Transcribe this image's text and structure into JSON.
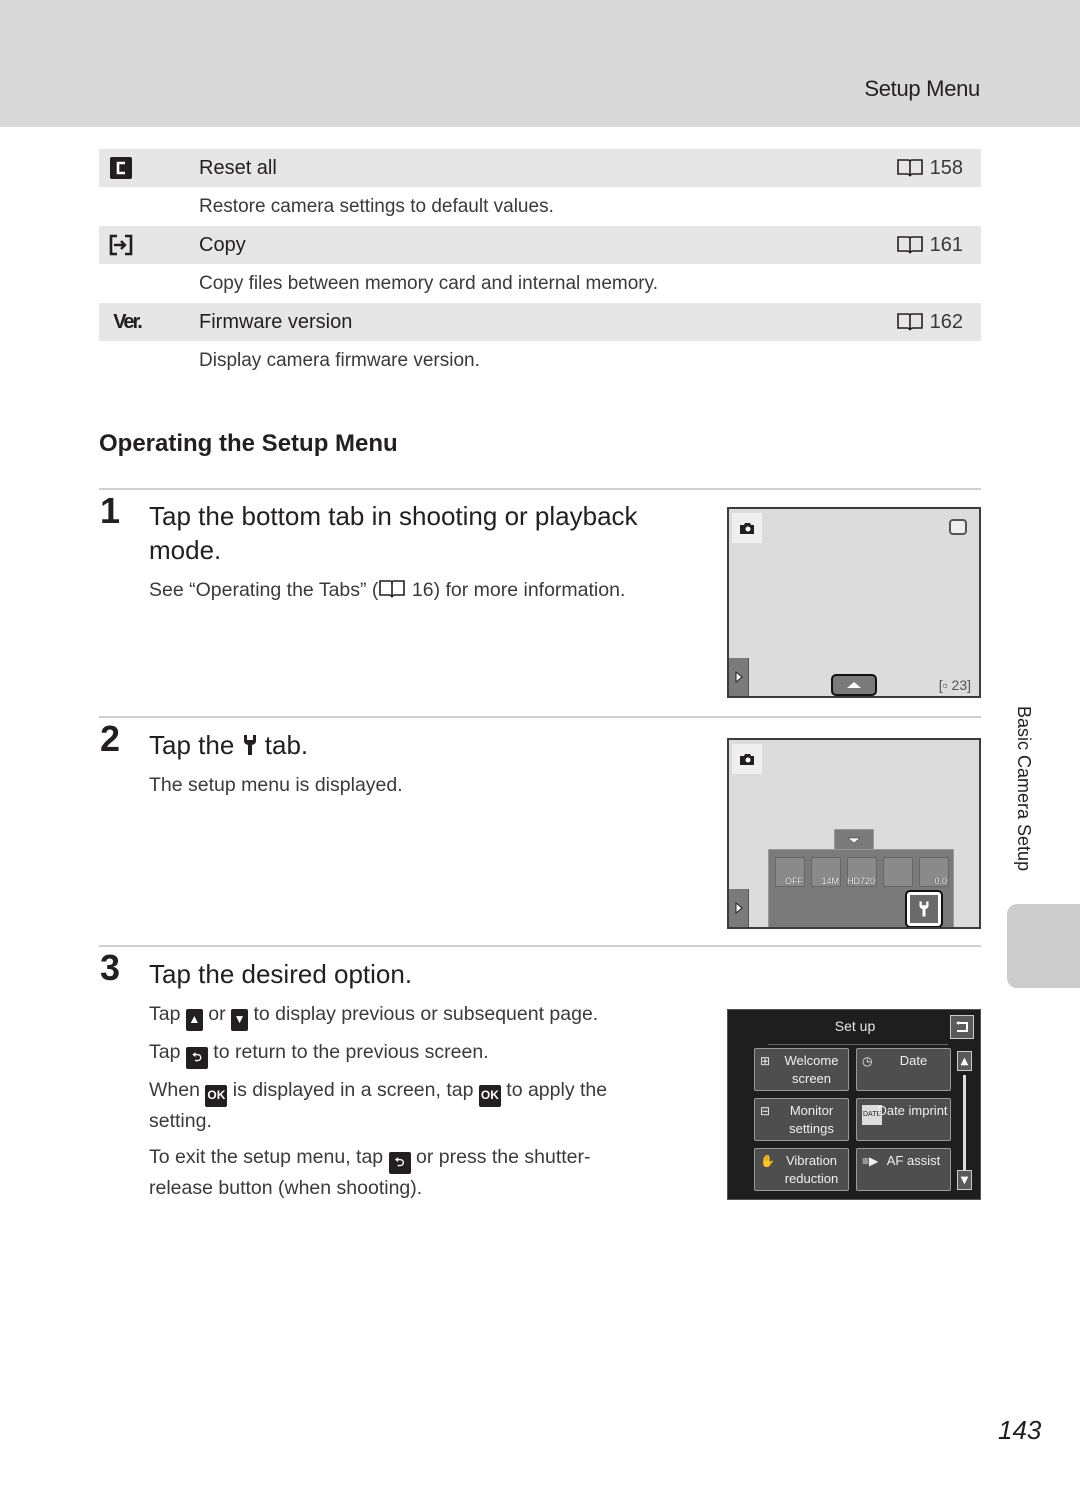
{
  "header": {
    "title": "Setup Menu"
  },
  "menu_items": [
    {
      "icon": "reset-all-icon",
      "glyph": "C",
      "label": "Reset all",
      "ref_page": "158",
      "description": "Restore camera settings to default values."
    },
    {
      "icon": "copy-icon",
      "glyph": "⇥",
      "label": "Copy",
      "ref_page": "161",
      "description": "Copy files between memory card and internal memory."
    },
    {
      "icon": "firmware-version-icon",
      "glyph": "Ver.",
      "label": "Firmware version",
      "ref_page": "162",
      "description": "Display camera firmware version."
    }
  ],
  "section": {
    "title": "Operating the Setup Menu"
  },
  "steps": [
    {
      "number": "1",
      "title_line1": "Tap the bottom tab in shooting or playback",
      "title_line2": "mode.",
      "text_before": "See “Operating the Tabs” (",
      "ref_page": "16",
      "text_after": ") for more information."
    },
    {
      "number": "2",
      "title_before": "Tap the",
      "title_after": "tab.",
      "text": "The setup menu is displayed."
    },
    {
      "number": "3",
      "title": "Tap the desired option.",
      "lines": {
        "l1_a": "Tap",
        "l1_b": "or",
        "l1_c": "to display previous or subsequent page.",
        "l2_a": "Tap",
        "l2_b": "to return to the previous screen.",
        "l3_a": "When",
        "l3_b": "is displayed in a screen, tap",
        "l3_c": "to apply the",
        "l3_d": "setting.",
        "l4_a": "To exit the setup menu, tap",
        "l4_b": "or press the shutter-",
        "l4_c": "release button (when shooting)."
      },
      "ok_label": "OK"
    }
  ],
  "screen1": {
    "frames_remaining": "23"
  },
  "screen2": {
    "tab_icons": [
      {
        "name": "self-timer-icon",
        "sub": "OFF"
      },
      {
        "name": "image-mode-icon",
        "sub": "14M"
      },
      {
        "name": "movie-options-icon",
        "sub": "HD720"
      },
      {
        "name": "touch-shooting-icon",
        "sub": ""
      },
      {
        "name": "exposure-compensation-icon",
        "sub": "0.0"
      }
    ]
  },
  "setup_screen": {
    "title": "Set up",
    "options": [
      {
        "label_l1": "Welcome",
        "label_l2": "screen"
      },
      {
        "label_l1": "Date",
        "label_l2": ""
      },
      {
        "label_l1": "Monitor",
        "label_l2": "settings"
      },
      {
        "label_l1": "Date imprint",
        "label_l2": "",
        "icon_text": "DATE"
      },
      {
        "label_l1": "Vibration",
        "label_l2": "reduction"
      },
      {
        "label_l1": "AF assist",
        "label_l2": ""
      }
    ]
  },
  "side_label": "Basic Camera Setup",
  "page_number": "143"
}
